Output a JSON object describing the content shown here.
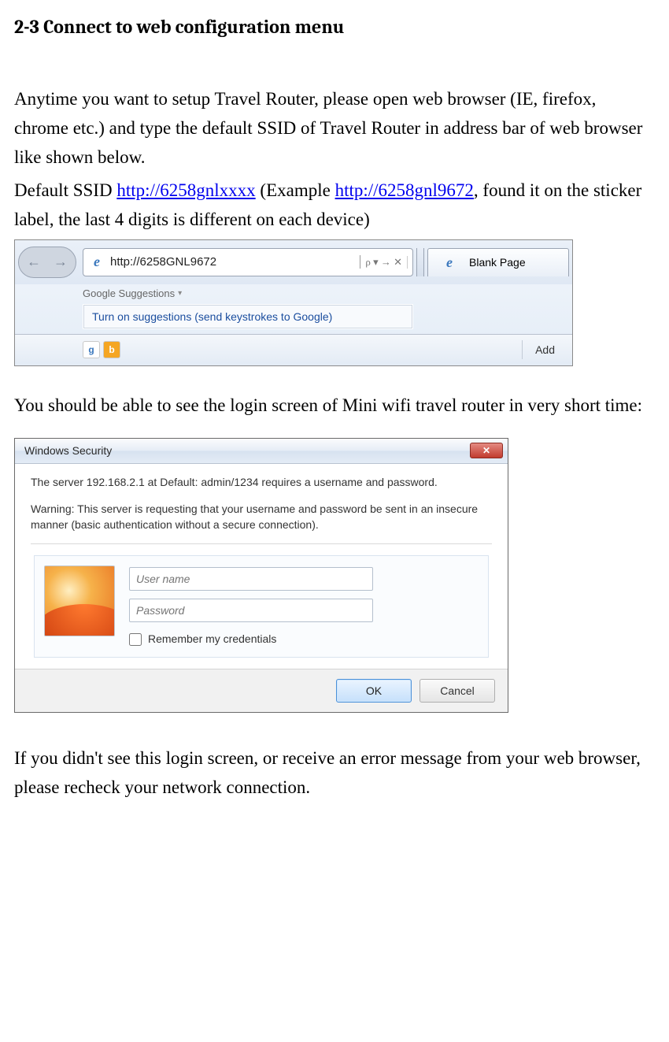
{
  "heading": "2-3 Connect to web configuration menu",
  "para1a": "Anytime you want to setup Travel Router, please open web browser (IE, firefox, chrome etc.) and type the default SSID of Travel Router in address bar of web browser like shown below.",
  "para1b_prefix": "Default SSID ",
  "link1": "http://6258gnlxxxx",
  "para1b_mid": " (Example ",
  "link2": "http://6258gnl9672",
  "para1b_suffix": ", found it on the sticker label, the last 4 digits is different on each device)",
  "browser": {
    "url": "http://6258GNL9672",
    "search_hint": "ρ ▾ → ✕",
    "tab_label": "Blank Page",
    "suggest_header": "Google Suggestions",
    "suggest_item": "Turn on suggestions (send keystrokes to Google)",
    "add_label": "Add"
  },
  "para2": "You should be able to see the login screen of Mini wifi travel router in very short time:",
  "dialog": {
    "title": "Windows Security",
    "msg1": "The server 192.168.2.1 at Default: admin/1234 requires a username and password.",
    "msg2": "Warning: This server is requesting that your username and password be sent in an insecure manner (basic authentication without a secure connection).",
    "user_placeholder": "User name",
    "pass_placeholder": "Password",
    "remember": "Remember my credentials",
    "ok": "OK",
    "cancel": "Cancel"
  },
  "para3": "If you didn't see this login screen, or receive an error message from your web browser, please recheck your network connection."
}
